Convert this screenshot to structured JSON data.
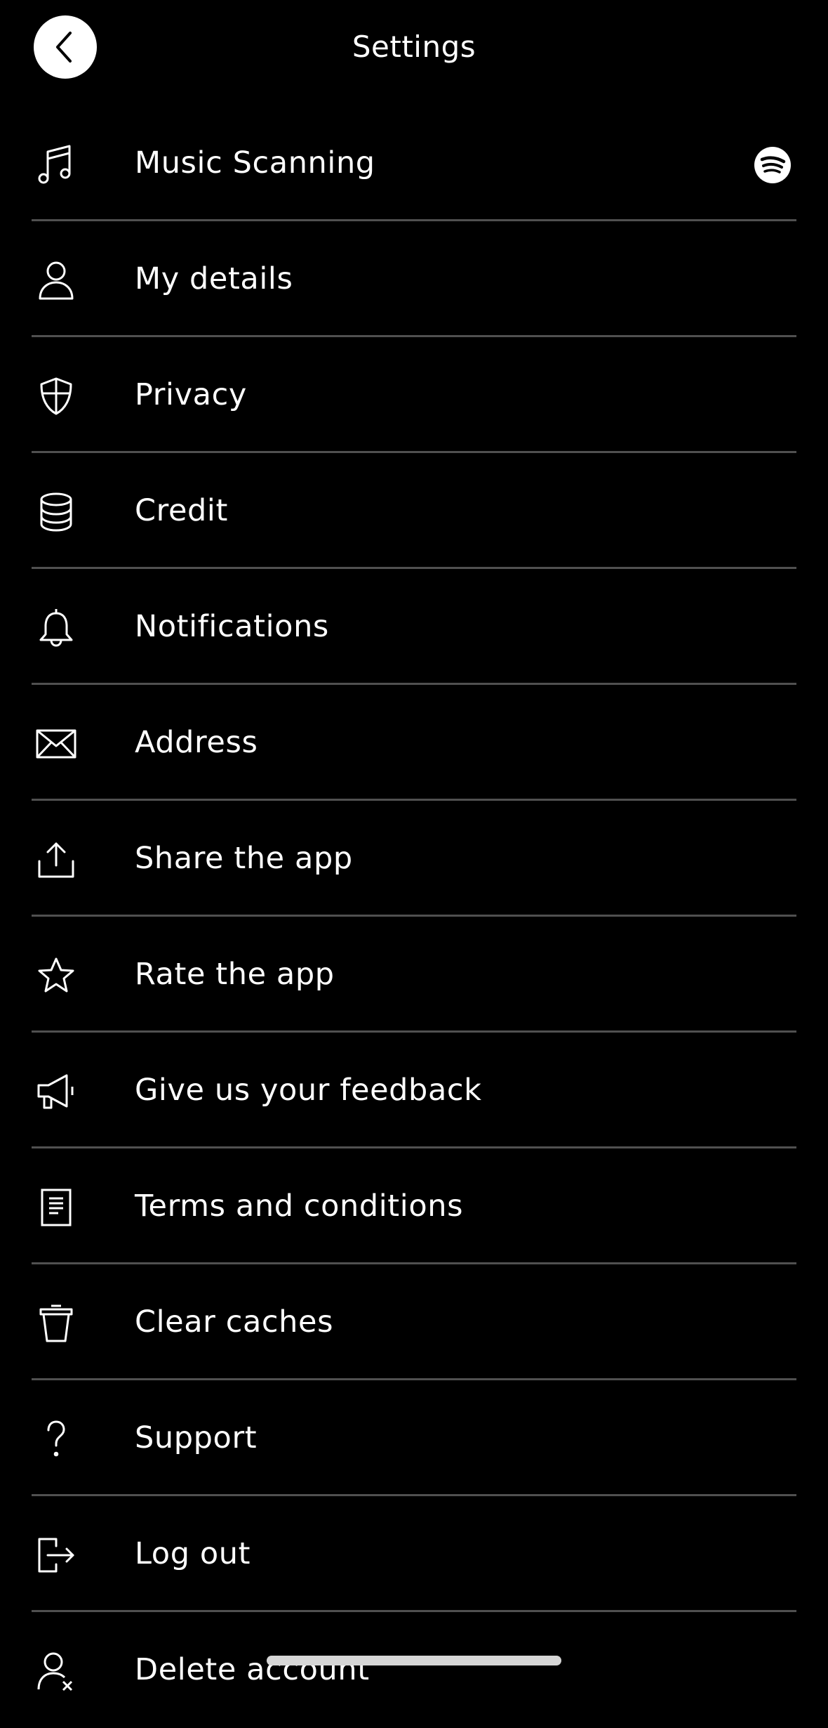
{
  "header": {
    "title": "Settings",
    "back_icon": "chevron-left-icon"
  },
  "settings": {
    "items": [
      {
        "key": "music-scanning",
        "label": "Music Scanning",
        "icon": "music-note-icon",
        "trailing_icon": "spotify-icon"
      },
      {
        "key": "my-details",
        "label": "My details",
        "icon": "user-icon"
      },
      {
        "key": "privacy",
        "label": "Privacy",
        "icon": "shield-icon"
      },
      {
        "key": "credit",
        "label": "Credit",
        "icon": "coin-stack-icon"
      },
      {
        "key": "notifications",
        "label": "Notifications",
        "icon": "bell-icon"
      },
      {
        "key": "address",
        "label": "Address",
        "icon": "envelope-icon"
      },
      {
        "key": "share-the-app",
        "label": "Share the app",
        "icon": "share-icon"
      },
      {
        "key": "rate-the-app",
        "label": "Rate the app",
        "icon": "star-icon"
      },
      {
        "key": "feedback",
        "label": "Give us your feedback",
        "icon": "megaphone-icon"
      },
      {
        "key": "terms",
        "label": "Terms and conditions",
        "icon": "document-icon"
      },
      {
        "key": "clear-caches",
        "label": "Clear caches",
        "icon": "trash-icon"
      },
      {
        "key": "support",
        "label": "Support",
        "icon": "question-mark-icon"
      },
      {
        "key": "log-out",
        "label": "Log out",
        "icon": "logout-icon"
      },
      {
        "key": "delete-account",
        "label": "Delete account",
        "icon": "user-remove-icon"
      }
    ]
  },
  "colors": {
    "background": "#000000",
    "text": "#ffffff",
    "divider": "#505050",
    "back_button_bg": "#ffffff"
  }
}
